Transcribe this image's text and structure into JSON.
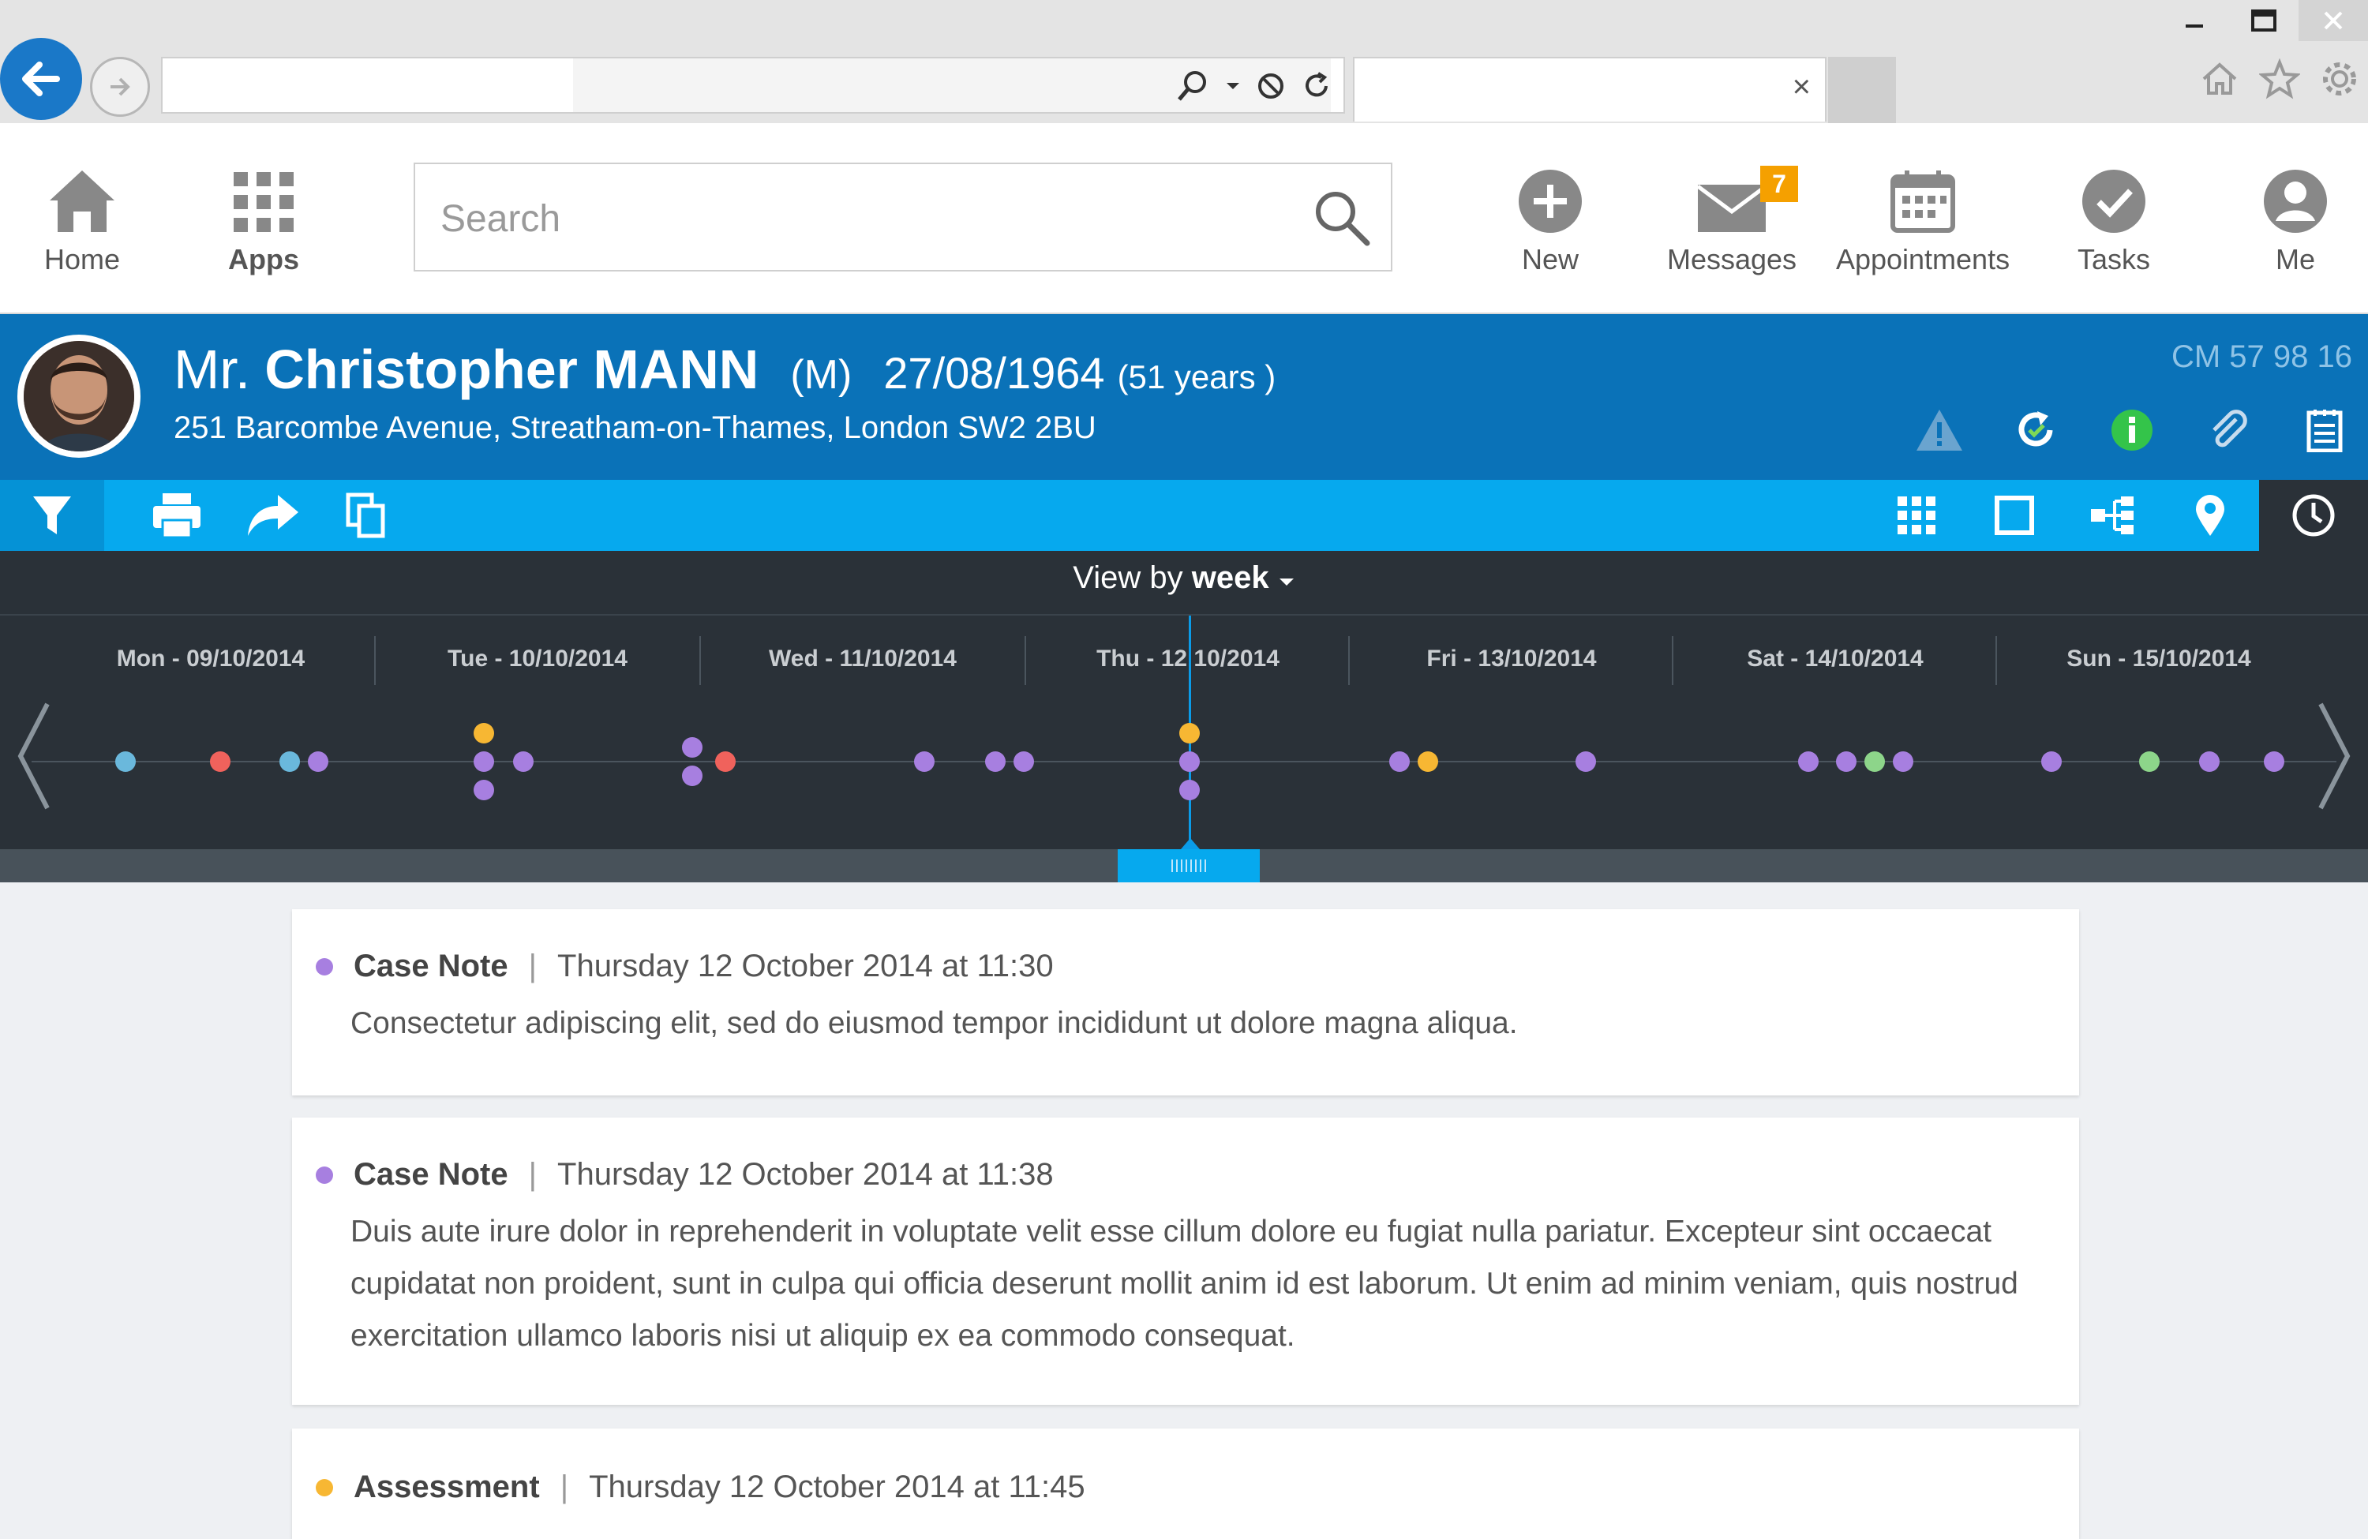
{
  "browser": {
    "address_value": "",
    "tab_title": "",
    "tab_close": "×"
  },
  "nav": {
    "home": "Home",
    "apps": "Apps",
    "search_placeholder": "Search",
    "new": "New",
    "messages": "Messages",
    "messages_badge": "7",
    "appointments": "Appointments",
    "tasks": "Tasks",
    "me": "Me"
  },
  "patient": {
    "title": "Mr.",
    "name": "Christopher MANN",
    "sex": "(M)",
    "dob": "27/08/1964",
    "age": "(51 years )",
    "address": "251 Barcombe Avenue, Streatham-on-Thames, London SW2 2BU",
    "id": "CM 57 98 16"
  },
  "timeline": {
    "view_by_label": "View by",
    "view_by_value": "week",
    "days": [
      "Mon - 09/10/2014",
      "Tue - 10/10/2014",
      "Wed - 11/10/2014",
      "Thu - 12 10/2014",
      "Fri - 13/10/2014",
      "Sat - 14/10/2014",
      "Sun - 15/10/2014"
    ],
    "colors": {
      "case_note": "#a77fe0",
      "assessment": "#f7b733",
      "teal": "#6ab8dc",
      "red": "#f0625c",
      "green": "#8dd58a",
      "accent": "#06a9ee",
      "header": "#0a72b8"
    }
  },
  "entries": [
    {
      "type": "Case Note",
      "datetime": "Thursday 12 October 2014  at  11:30",
      "text": "Consectetur adipiscing elit, sed do eiusmod tempor incididunt ut dolore magna aliqua.",
      "color": "#a77fe0"
    },
    {
      "type": "Case Note",
      "datetime": "Thursday 12 October 2014  at  11:38",
      "text": "Duis aute irure dolor in reprehenderit in voluptate velit esse cillum dolore eu fugiat nulla pariatur. Excepteur sint occaecat cupidatat non proident, sunt in culpa qui officia deserunt mollit anim id est laborum. Ut enim ad minim veniam, quis nostrud exercitation ullamco laboris nisi ut aliquip ex ea commodo consequat.",
      "color": "#a77fe0"
    },
    {
      "type": "Assessment",
      "datetime": "Thursday 12 October 2014  at  11:45",
      "text": "",
      "color": "#f7b733"
    }
  ]
}
